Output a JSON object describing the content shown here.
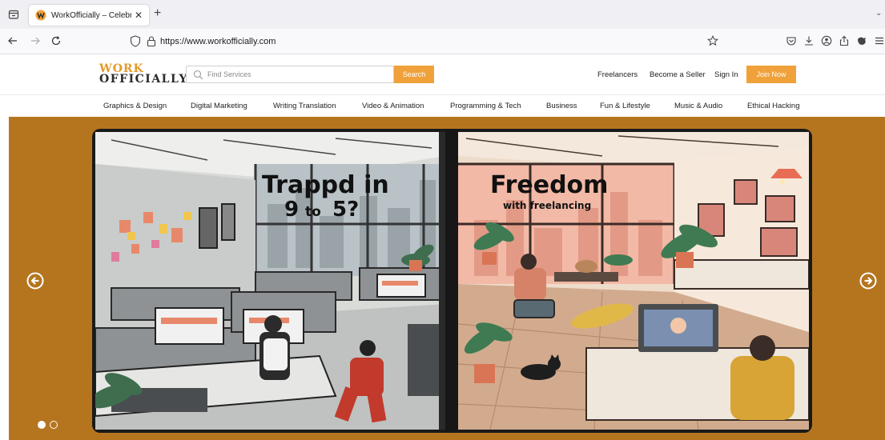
{
  "browser": {
    "tab_title": "WorkOfficially – Celebrating Eve",
    "url": "https://www.workofficially.com"
  },
  "site": {
    "logo_line1": "WORK",
    "logo_line2": "OFFICIALLY",
    "search_placeholder": "Find Services",
    "search_button": "Search",
    "nav": {
      "freelancers": "Freelancers",
      "become_seller": "Become a Seller",
      "sign_in": "Sign In",
      "join_now": "Join Now"
    },
    "categories": [
      "Graphics & Design",
      "Digital Marketing",
      "Writing Translation",
      "Video & Animation",
      "Programming & Tech",
      "Business",
      "Fun & Lifestyle",
      "Music & Audio",
      "Ethical Hacking"
    ]
  },
  "hero": {
    "left_line1": "Trappd in",
    "left_line2a": "9",
    "left_line2b": "to",
    "left_line2c": "5?",
    "right_line1": "Freedom",
    "right_line2": "with freelancing",
    "slide_count": 2,
    "active_slide": 1
  },
  "colors": {
    "accent": "#f0a13a",
    "hero_bg": "#b5751f",
    "logo_orange": "#e39b2a"
  }
}
